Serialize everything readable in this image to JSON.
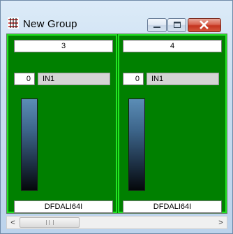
{
  "window": {
    "title": "New Group",
    "icon": "grid-app-icon"
  },
  "titlebar_buttons": {
    "minimize_icon": "minimize-icon",
    "maximize_icon": "maximize-icon",
    "close_icon": "close-icon"
  },
  "strips": [
    {
      "channel_number": "3",
      "value": "0",
      "input_label": "IN1",
      "device_name": "DFDALI64I"
    },
    {
      "channel_number": "4",
      "value": "0",
      "input_label": "IN1",
      "device_name": "DFDALI64I"
    }
  ],
  "scrollbar": {
    "left_arrow": "<",
    "right_arrow": ">"
  },
  "colors": {
    "panel_background": "#008000",
    "strip_border": "#22e322",
    "close_button": "#c4341f"
  }
}
